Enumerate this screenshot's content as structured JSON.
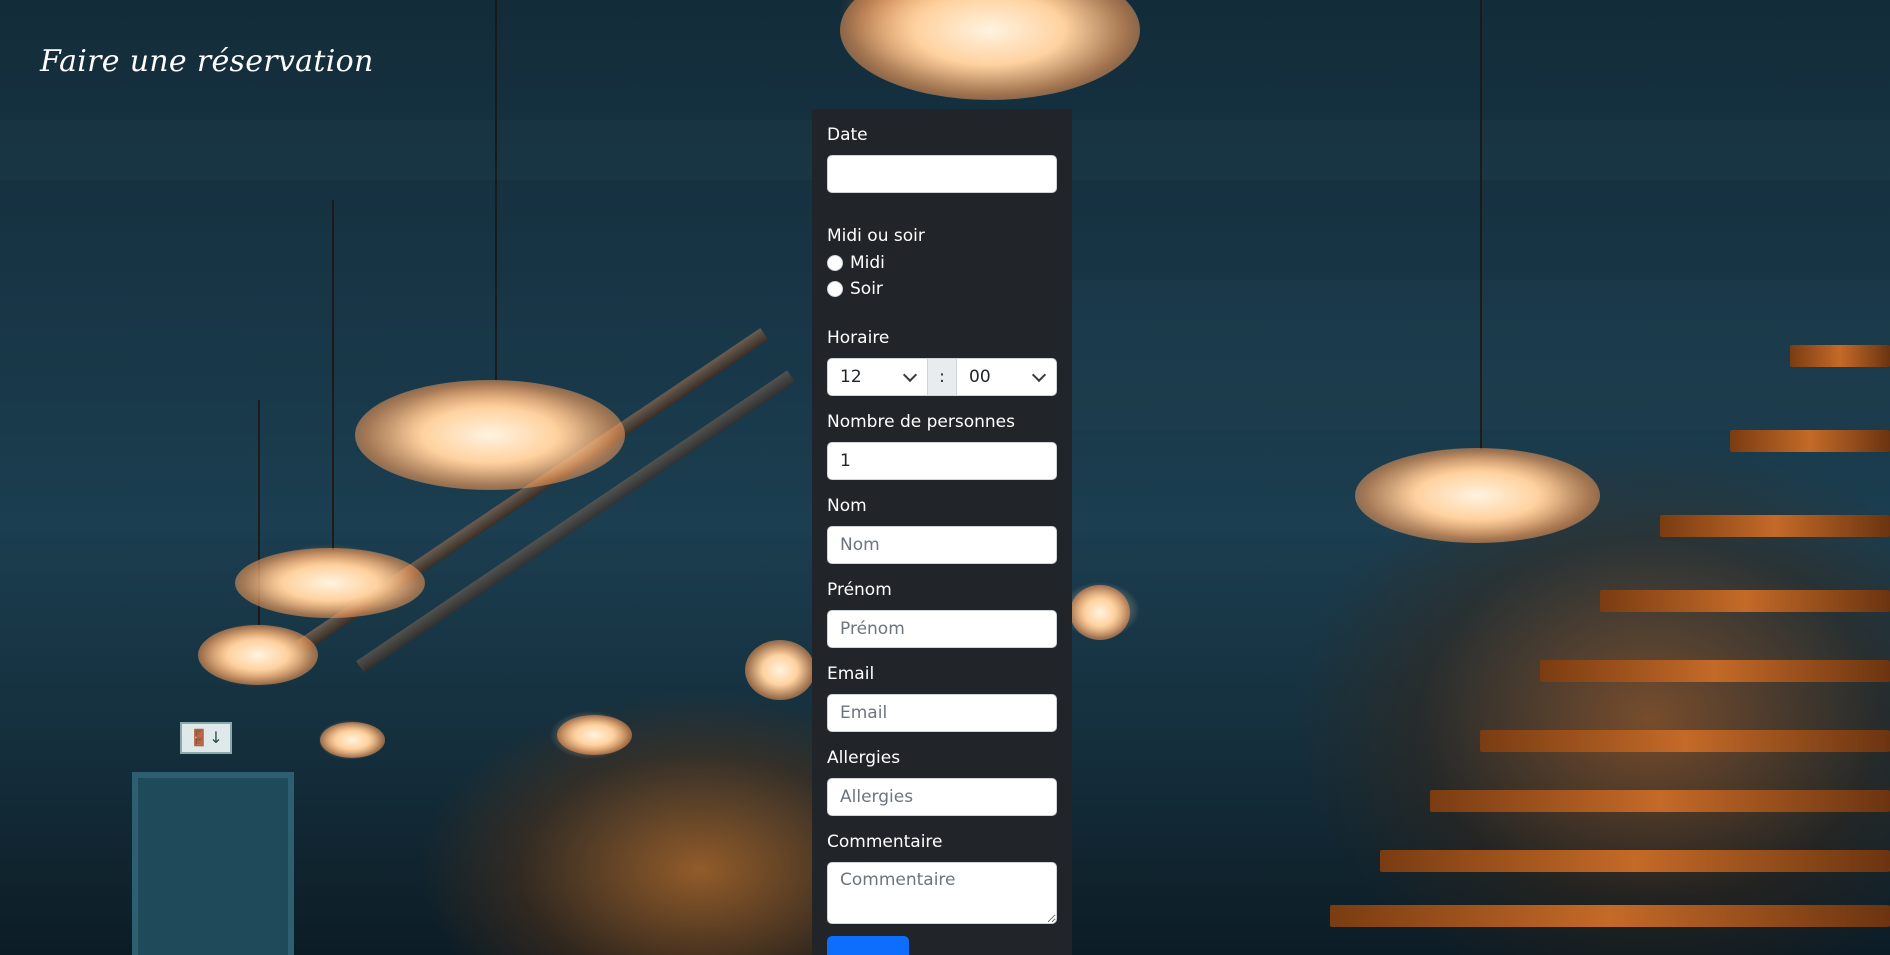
{
  "page": {
    "title": "Faire une réservation"
  },
  "form": {
    "date": {
      "label": "Date",
      "value": ""
    },
    "service": {
      "label": "Midi ou soir",
      "options": [
        "Midi",
        "Soir"
      ]
    },
    "time": {
      "label": "Horaire",
      "hour": "12",
      "separator": ":",
      "minute": "00"
    },
    "guests": {
      "label": "Nombre de personnes",
      "value": "1"
    },
    "last_name": {
      "label": "Nom",
      "placeholder": "Nom"
    },
    "first_name": {
      "label": "Prénom",
      "placeholder": "Prénom"
    },
    "email": {
      "label": "Email",
      "placeholder": "Email"
    },
    "allergies": {
      "label": "Allergies",
      "placeholder": "Allergies"
    },
    "comment": {
      "label": "Commentaire",
      "placeholder": "Commentaire"
    }
  },
  "colors": {
    "panel_background": "#212529",
    "submit_button": "#0d6efd"
  }
}
